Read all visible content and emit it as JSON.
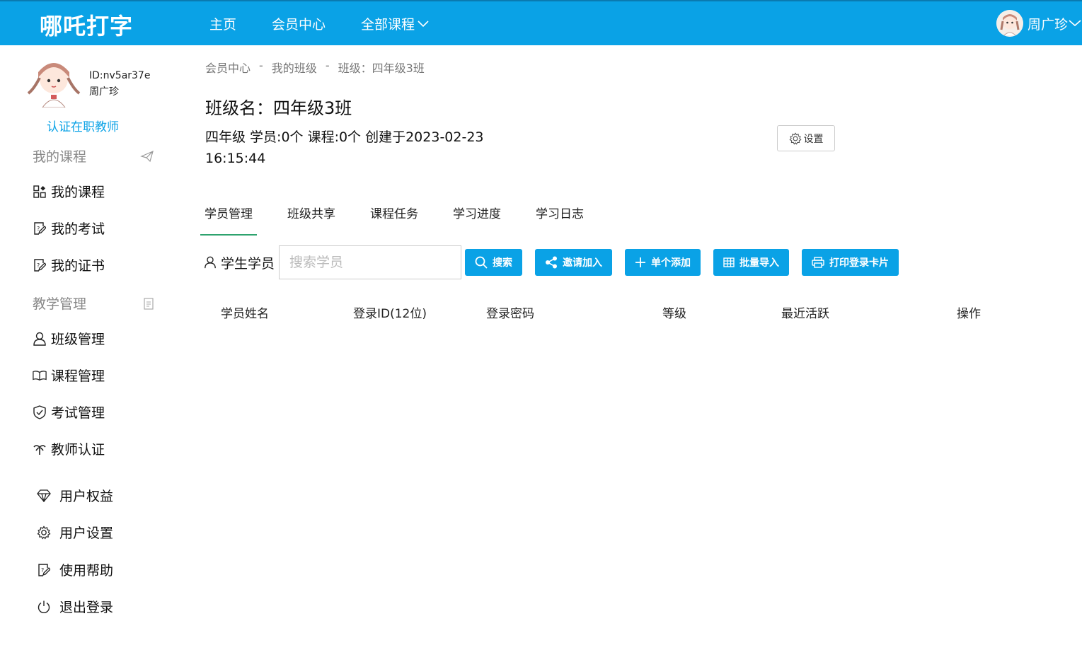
{
  "header": {
    "logo": "哪吒打字",
    "nav": [
      "主页",
      "会员中心",
      "全部课程"
    ],
    "user_name": "周广珍"
  },
  "sidebar": {
    "profile_id": "ID:nv5ar37e",
    "profile_name": "周广珍",
    "verify_label": "认证在职教师",
    "section_courses": "我的课程",
    "course_items": [
      "我的课程",
      "我的考试",
      "我的证书"
    ],
    "section_teaching": "教学管理",
    "teaching_items": [
      "班级管理",
      "课程管理",
      "考试管理",
      "教师认证"
    ],
    "account_items": [
      "用户权益",
      "用户设置",
      "使用帮助",
      "退出登录"
    ]
  },
  "breadcrumb": [
    "会员中心",
    "我的班级",
    "班级：四年级3班"
  ],
  "breadcrumb_sep": "-",
  "class": {
    "title": "班级名：四年级3班",
    "info": "四年级 学员:0个 课程:0个 创建于2023-02-23 16:15:44",
    "settings_label": "设置"
  },
  "tabs": [
    "学员管理",
    "班级共享",
    "课程任务",
    "学习进度",
    "学习日志"
  ],
  "toolbar": {
    "label": "学生学员",
    "search_placeholder": "搜索学员",
    "search_value": "",
    "buttons": [
      "搜索",
      "邀请加入",
      "单个添加",
      "批量导入",
      "打印登录卡片"
    ]
  },
  "table": {
    "columns": [
      "学员姓名",
      "登录ID(12位)",
      "登录密码",
      "等级",
      "最近活跃",
      "操作"
    ]
  },
  "colors": {
    "brand": "#0aa2e6",
    "tab_active": "#2ea36e"
  }
}
